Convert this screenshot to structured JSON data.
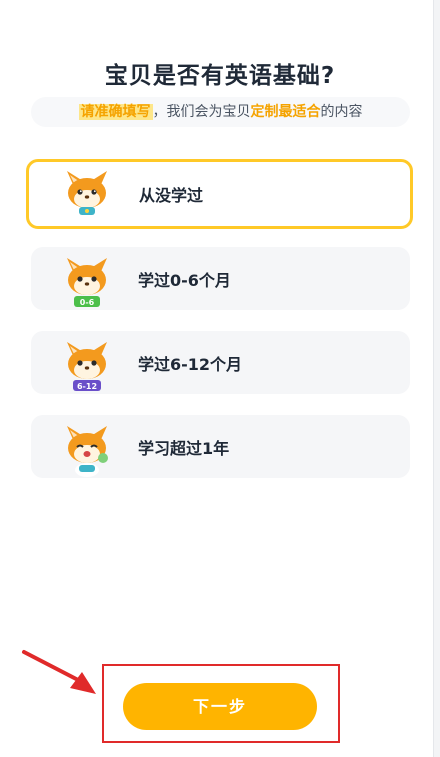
{
  "page": {
    "title": "宝贝是否有英语基础?",
    "subtitle": {
      "part1": "请准确填写",
      "part2": "，我们会为宝贝",
      "part3": "定制最适合",
      "part4": "的内容"
    }
  },
  "options": [
    {
      "label": "从没学过",
      "selected": true,
      "badge": ""
    },
    {
      "label": "学过0-6个月",
      "selected": false,
      "badge": "0-6"
    },
    {
      "label": "学过6-12个月",
      "selected": false,
      "badge": "6-12"
    },
    {
      "label": "学习超过1年",
      "selected": false,
      "badge": ""
    }
  ],
  "footer": {
    "next_label": "下一步"
  },
  "colors": {
    "accent": "#ffb400",
    "selected_border": "#ffc928",
    "highlight_frame": "#e02a2a",
    "fox_orange": "#f39a1e"
  }
}
